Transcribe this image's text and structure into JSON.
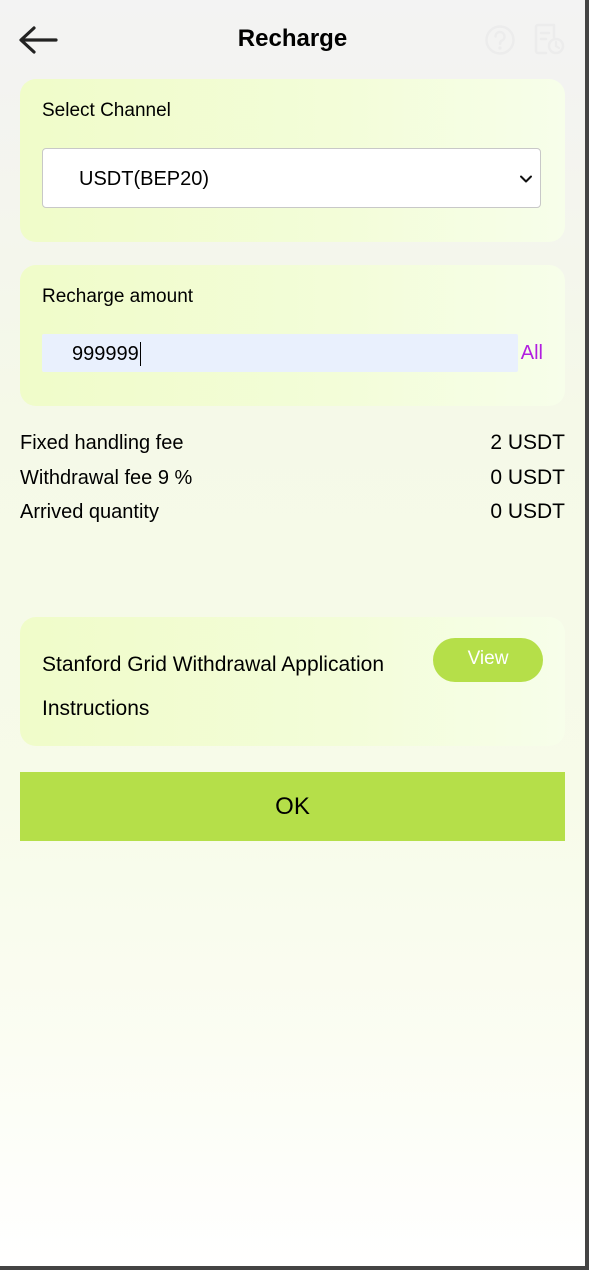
{
  "header": {
    "title": "Recharge",
    "back_icon": "arrow-left-icon",
    "help_icon": "question-circle-icon",
    "record_icon": "document-clock-icon"
  },
  "channel": {
    "label": "Select Channel",
    "selected": "USDT(BEP20)"
  },
  "amount": {
    "label": "Recharge amount",
    "value": "999999",
    "all_label": "All"
  },
  "fees": [
    {
      "label": "Fixed handling fee",
      "value": "2 USDT"
    },
    {
      "label": "Withdrawal fee 9 %",
      "value": "0 USDT"
    },
    {
      "label": "Arrived quantity",
      "value": "0 USDT"
    }
  ],
  "instructions": {
    "text": "Stanford Grid Withdrawal Application Instructions",
    "view_label": "View"
  },
  "ok_label": "OK",
  "colors": {
    "accent": "#b5df49",
    "link": "#b21ee0",
    "input_bg": "#e9f0fd"
  }
}
